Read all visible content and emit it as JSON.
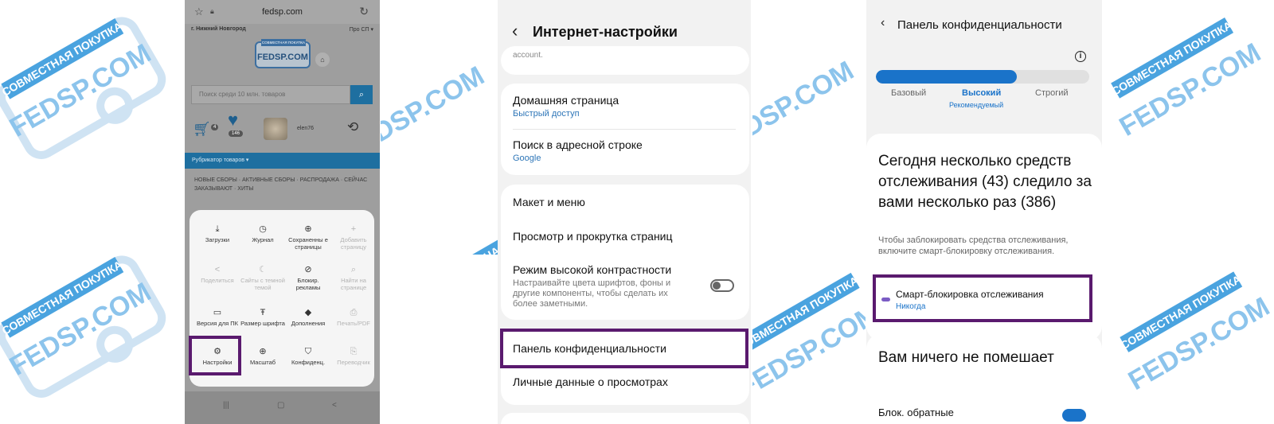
{
  "watermark": {
    "line1": "СОВМЕСТНАЯ ПОКУПКА",
    "line2": "FEDSP.COM"
  },
  "screen1": {
    "url": "fedsp.com",
    "city": "г. Нижний Новгород",
    "about": "Про СП ▾",
    "logo_ribbon": "СОВМЕСТНАЯ ПОКУПКА",
    "logo_text": "FEDSP.COM",
    "search_placeholder": "Поиск среди 10 млн. товаров",
    "cart_count": "4",
    "fav_count": "146",
    "username": "elen76",
    "rubricator": "Рубрикатор товаров ▾",
    "categories": "НОВЫЕ СБОРЫ · АКТИВНЫЕ СБОРЫ · РАСПРОДАЖА · СЕЙЧАС ЗАКАЗЫВАЮТ · ХИТЫ",
    "menu": [
      {
        "label": "Загрузки",
        "icon": "⤓",
        "enabled": true
      },
      {
        "label": "Журнал",
        "icon": "◷",
        "enabled": true
      },
      {
        "label": "Сохраненны е страницы",
        "icon": "⊕",
        "enabled": true
      },
      {
        "label": "Добавить страницу",
        "icon": "+",
        "enabled": false
      },
      {
        "label": "Поделиться",
        "icon": "<",
        "enabled": false
      },
      {
        "label": "Сайты с темной темой",
        "icon": "☾",
        "enabled": false
      },
      {
        "label": "Блокир. рекламы",
        "icon": "⊘",
        "enabled": true
      },
      {
        "label": "Найти на странице",
        "icon": "⌕",
        "enabled": false
      },
      {
        "label": "Версия для ПК",
        "icon": "▭",
        "enabled": true
      },
      {
        "label": "Размер шрифта",
        "icon": "Ŧ",
        "enabled": true
      },
      {
        "label": "Дополнения",
        "icon": "◆",
        "enabled": true
      },
      {
        "label": "Печать/PDF",
        "icon": "⎙",
        "enabled": false
      },
      {
        "label": "Настройки",
        "icon": "⚙",
        "enabled": true
      },
      {
        "label": "Масштаб",
        "icon": "⊕",
        "enabled": true
      },
      {
        "label": "Конфиденц.",
        "icon": "⛉",
        "enabled": true
      },
      {
        "label": "Переводчик",
        "icon": "⎘",
        "enabled": false
      }
    ],
    "nav": [
      "|||",
      "▢",
      "<"
    ]
  },
  "screen2": {
    "title": "Интернет-настройки",
    "cut_text": "account.",
    "rows": {
      "home_title": "Домашняя страница",
      "home_sub": "Быстрый доступ",
      "search_title": "Поиск в адресной строке",
      "search_sub": "Google",
      "layout_title": "Макет и меню",
      "scroll_title": "Просмотр и прокрутка страниц",
      "contrast_title": "Режим высокой контрастности",
      "contrast_desc": "Настраивайте цвета шрифтов, фоны и другие компоненты, чтобы сделать их более заметными.",
      "privacy_title": "Панель конфиденциальности",
      "personal_title": "Личные данные о просмотрах"
    }
  },
  "screen3": {
    "title": "Панель конфиденциальности",
    "levels": [
      "Базовый",
      "Высокий",
      "Строгий"
    ],
    "selected_level_index": 1,
    "level_fill_fraction": 0.66,
    "recommended": "Рекомендуемый",
    "headline": "Сегодня несколько средств отслеживания (43) следило за вами несколько раз (386)",
    "desc": "Чтобы заблокировать средства отслеживания, включите смарт-блокировку отслеживания.",
    "smart_title": "Смарт-блокировка отслеживания",
    "smart_sub": "Никогда",
    "headline2": "Вам ничего не помешает",
    "block_label": "Блок. обратные"
  },
  "colors": {
    "accent": "#1a73c9",
    "highlight": "#5a1a6e",
    "watermark": "#4aa3df"
  }
}
